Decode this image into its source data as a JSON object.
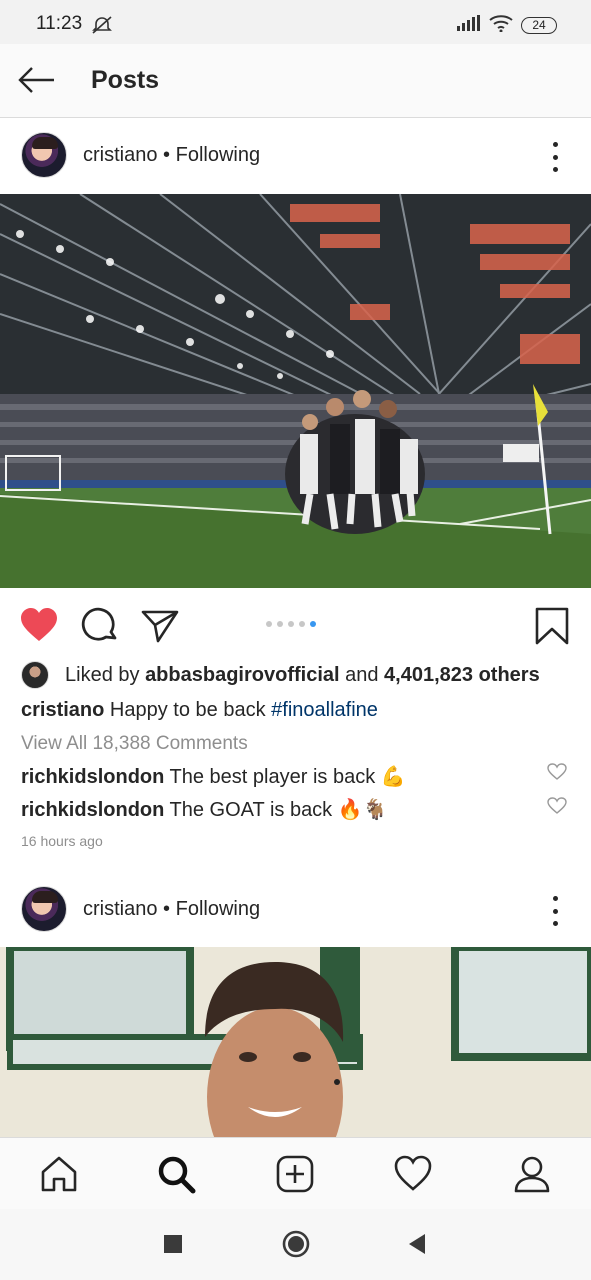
{
  "status_bar": {
    "time": "11:23",
    "battery": "24"
  },
  "header": {
    "title": "Posts"
  },
  "posts": [
    {
      "username": "cristiano",
      "following_label": " • Following",
      "carousel": {
        "count": 5,
        "active_index": 4
      },
      "liked_by_prefix": "Liked by ",
      "liked_by_user": "abbasbagirovofficial",
      "liked_by_and": " and ",
      "liked_by_others": "4,401,823 others",
      "caption_user": "cristiano",
      "caption_text": " Happy to be back ",
      "caption_hashtag": "#finoallafine",
      "view_all": "View All 18,388 Comments",
      "comments": [
        {
          "user": "richkidslondon",
          "text": " The best player is back 💪"
        },
        {
          "user": "richkidslondon",
          "text": " The GOAT is back 🔥🐐"
        }
      ],
      "timestamp": "16 hours ago"
    },
    {
      "username": "cristiano",
      "following_label": " • Following"
    }
  ],
  "bottom_nav": [
    "home-icon",
    "search-icon",
    "add-post-icon",
    "activity-heart-icon",
    "profile-icon"
  ],
  "system_nav": [
    "recents-icon",
    "home-circle-icon",
    "back-triangle-icon"
  ],
  "colors": {
    "like_red": "#ed4956",
    "hashtag": "#003569",
    "dot_active": "#3897f0",
    "muted": "#8e8e8e"
  }
}
